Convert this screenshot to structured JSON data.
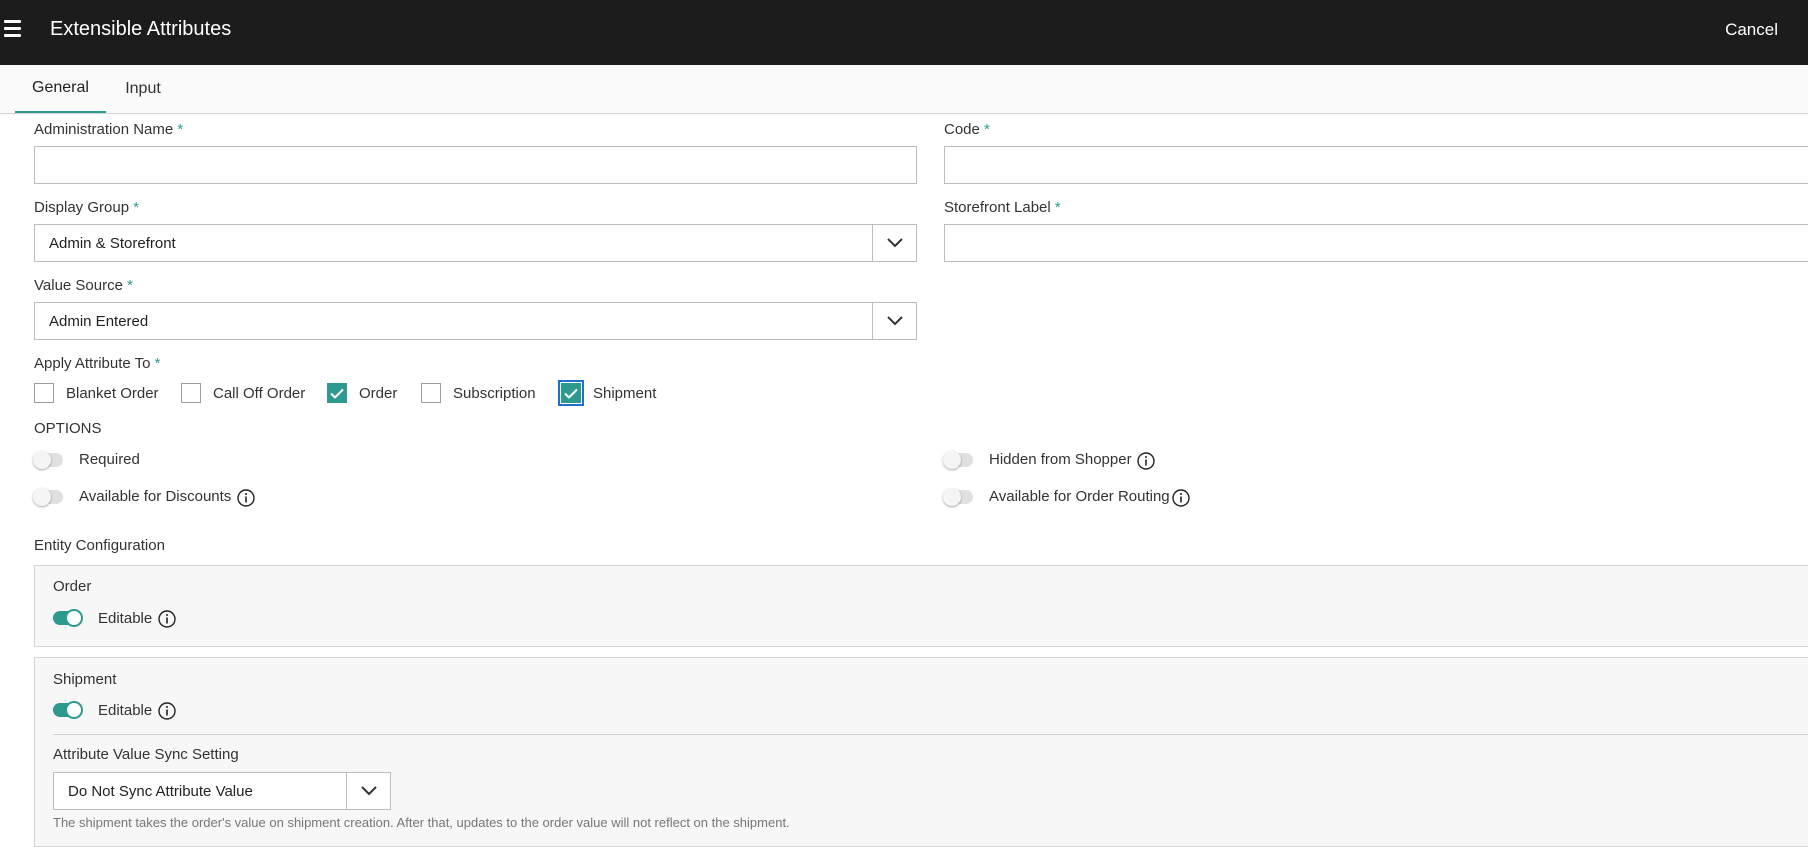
{
  "header": {
    "title": "Extensible Attributes",
    "cancel_label": "Cancel"
  },
  "tabs": [
    {
      "label": "General",
      "active": true
    },
    {
      "label": "Input",
      "active": false
    }
  ],
  "form": {
    "admin_name": {
      "label": "Administration Name",
      "required_mark": "*",
      "value": ""
    },
    "code": {
      "label": "Code",
      "required_mark": "*",
      "value": ""
    },
    "display_group": {
      "label": "Display Group",
      "required_mark": "*",
      "value": "Admin & Storefront"
    },
    "storefront_label": {
      "label": "Storefront Label",
      "required_mark": "*",
      "value": ""
    },
    "value_source": {
      "label": "Value Source",
      "required_mark": "*",
      "value": "Admin Entered"
    },
    "apply_to": {
      "label": "Apply Attribute To",
      "required_mark": "*",
      "options": [
        {
          "label": "Blanket Order",
          "checked": false
        },
        {
          "label": "Call Off Order",
          "checked": false
        },
        {
          "label": "Order",
          "checked": true
        },
        {
          "label": "Subscription",
          "checked": false
        },
        {
          "label": "Shipment",
          "checked": true
        }
      ]
    }
  },
  "options": {
    "heading": "OPTIONS",
    "required": {
      "label": "Required",
      "on": false
    },
    "available_for_discounts": {
      "label": "Available for Discounts",
      "on": false
    },
    "hidden_from_shopper": {
      "label": "Hidden from Shopper",
      "on": false
    },
    "available_for_order_routing": {
      "label": "Available for Order Routing",
      "on": false
    }
  },
  "entity_config": {
    "heading": "Entity Configuration",
    "order": {
      "title": "Order",
      "editable_label": "Editable",
      "editable_on": true
    },
    "shipment": {
      "title": "Shipment",
      "editable_label": "Editable",
      "editable_on": true,
      "sync_label": "Attribute Value Sync Setting",
      "sync_value": "Do Not Sync Attribute Value",
      "help": "The shipment takes the order's value on shipment creation. After that, updates to the order value will not reflect on the shipment."
    }
  },
  "colors": {
    "accent": "#2e9a8f",
    "topbar": "#1c1c1c"
  },
  "icons": [
    "menu-icon",
    "chevron-down-icon",
    "check-icon",
    "info-icon"
  ]
}
